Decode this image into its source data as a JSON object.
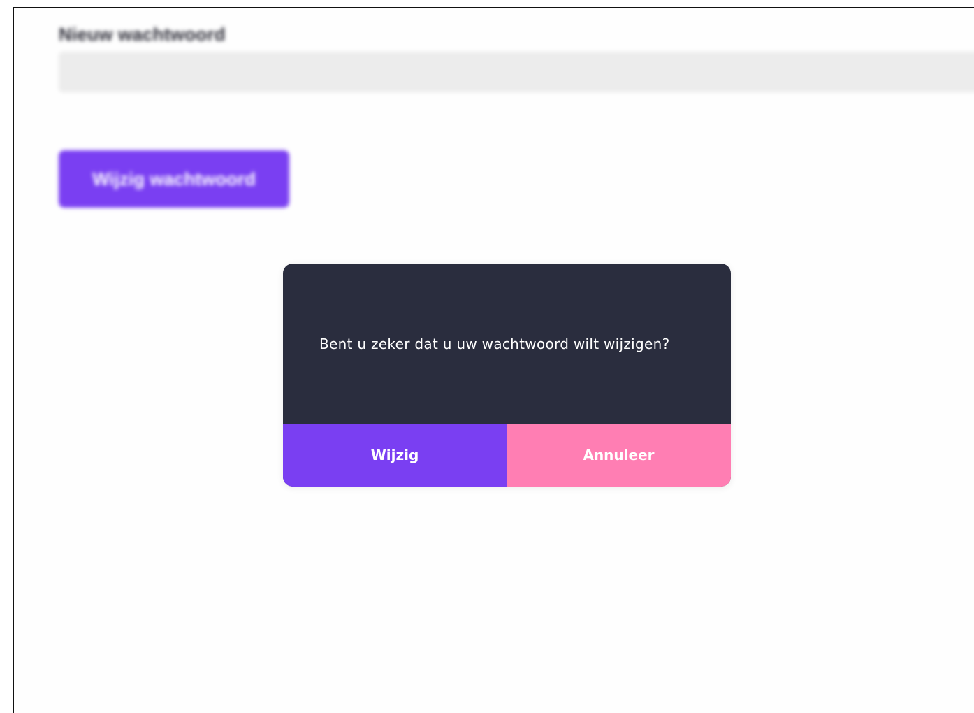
{
  "background": {
    "field_label": "Nieuw wachtwoord",
    "input_value": "",
    "input_placeholder": "",
    "submit_label": "Wijzig wachtwoord"
  },
  "dialog": {
    "message": "Bent u zeker dat u uw wachtwoord wilt wijzigen?",
    "confirm_label": "Wijzig",
    "cancel_label": "Annuleer"
  },
  "colors": {
    "primary": "#7a3ff2",
    "secondary": "#ff7eb3",
    "dialog_background": "#2a2d3e",
    "input_background": "#ececec"
  }
}
